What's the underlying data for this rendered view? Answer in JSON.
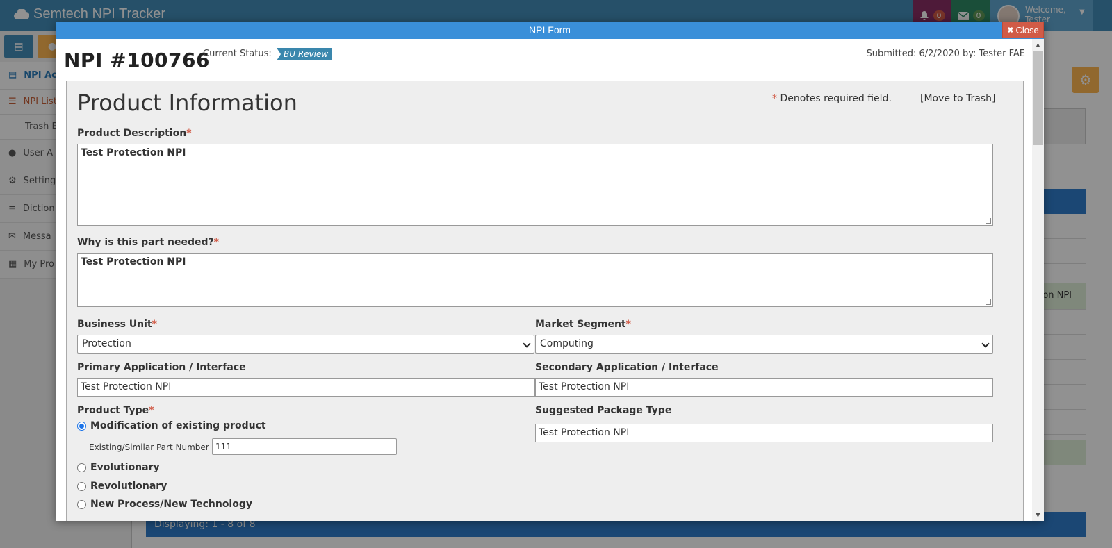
{
  "app": {
    "title": "Semtech NPI Tracker",
    "notifications_count": "0",
    "messages_count": "0",
    "welcome_line1": "Welcome,",
    "welcome_line2": "Tester"
  },
  "sidebar": {
    "items": [
      {
        "label": "NPI Ac",
        "icon": "file-icon"
      },
      {
        "label": "NPI List",
        "icon": "list-icon"
      },
      {
        "label": "Trash B",
        "icon": "none"
      },
      {
        "label": "User A",
        "icon": "users-icon"
      },
      {
        "label": "Setting",
        "icon": "gear-icon"
      },
      {
        "label": "Diction",
        "icon": "database-icon"
      },
      {
        "label": "Messa",
        "icon": "comments-icon"
      },
      {
        "label": "My Pro",
        "icon": "newspaper-icon"
      }
    ]
  },
  "background": {
    "row_fragment": "on NPI",
    "footer_text": "Displaying: 1 - 8 of 8"
  },
  "modal": {
    "title": "NPI Form",
    "close_label": "Close",
    "npi_number": "NPI #100766",
    "status_label": "Current Status:",
    "status_value": "BU Review",
    "submitted": "Submitted: 6/2/2020 by: Tester FAE"
  },
  "form": {
    "section_title": "Product Information",
    "required_note_star": "*",
    "required_note": "Denotes required field.",
    "trash_link": "[Move to Trash]",
    "product_description": {
      "label": "Product Description",
      "value": "Test Protection NPI"
    },
    "why_needed": {
      "label": "Why is this part needed?",
      "value": "Test Protection NPI"
    },
    "business_unit": {
      "label": "Business Unit",
      "value": "Protection"
    },
    "market_segment": {
      "label": "Market Segment",
      "value": "Computing"
    },
    "primary_app": {
      "label": "Primary Application / Interface",
      "value": "Test Protection NPI"
    },
    "secondary_app": {
      "label": "Secondary Application / Interface",
      "value": "Test Protection NPI"
    },
    "product_type": {
      "label": "Product Type",
      "options": [
        {
          "label": "Modification of existing product",
          "checked": true
        },
        {
          "label": "Evolutionary",
          "checked": false
        },
        {
          "label": "Revolutionary",
          "checked": false
        },
        {
          "label": "New Process/New Technology",
          "checked": false
        }
      ],
      "existing_part_label": "Existing/Similar Part Number",
      "existing_part_value": "111"
    },
    "package_type": {
      "label": "Suggested Package Type",
      "value": "Test Protection NPI"
    },
    "required_star": "*"
  },
  "colors": {
    "brand": "#438eb9",
    "modal_header": "#3a8fd9",
    "close_button": "#d15b47",
    "status_tag": "#3a87ad",
    "required": "#d15b47"
  }
}
